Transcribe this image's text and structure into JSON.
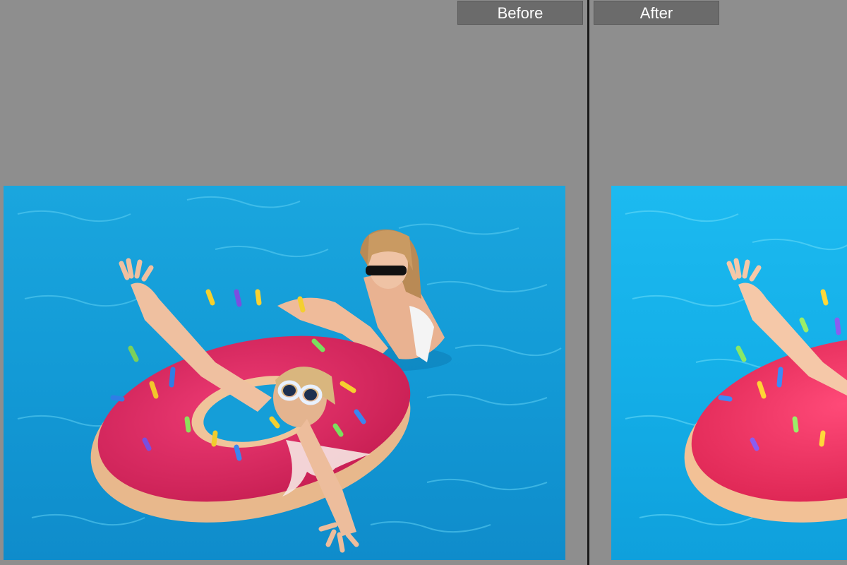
{
  "view": {
    "mode": "before-after-split",
    "before_label": "Before",
    "after_label": "After"
  },
  "photos": {
    "before": {
      "description_icon": "photo-pool-donut-float",
      "water_color": "#169fd9",
      "float_color": "#e0245e"
    },
    "after": {
      "description_icon": "photo-pool-donut-float-edited",
      "water_color": "#15b3ea",
      "float_color": "#ee2e5c"
    }
  },
  "colors": {
    "background": "#8e8e8e",
    "label_bg": "#6b6b6b",
    "divider": "#1a1a1a"
  }
}
